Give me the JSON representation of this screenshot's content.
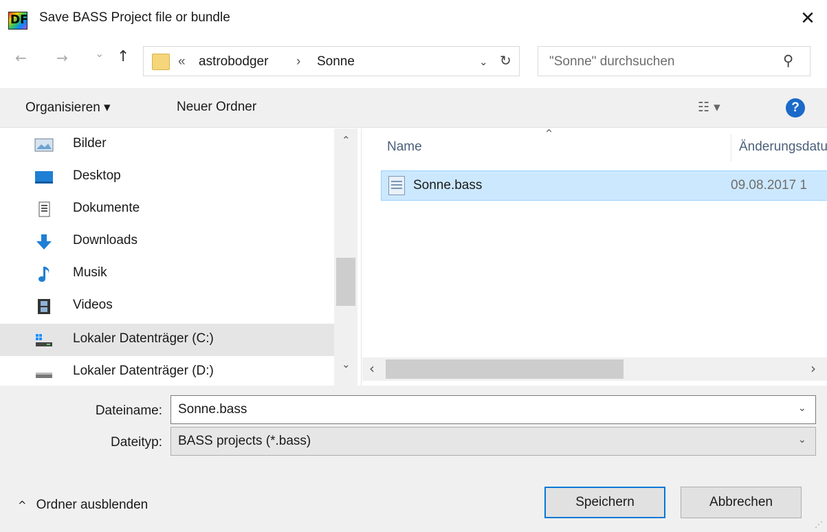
{
  "window": {
    "title": "Save BASS Project file or bundle",
    "close_glyph": "✕",
    "app_icon_text": "DF"
  },
  "nav": {
    "back_glyph": "←",
    "forward_glyph": "→",
    "recent_glyph": "⌄",
    "up_glyph": "↑",
    "breadcrumb_prefix": "«",
    "breadcrumb": [
      "astrobodger",
      "Sonne"
    ],
    "breadcrumb_sep": "›",
    "address_dropdown_glyph": "⌄",
    "refresh_glyph": "↻",
    "search_placeholder": "\"Sonne\" durchsuchen",
    "search_glyph": "⚲"
  },
  "toolbar": {
    "organize_label": "Organisieren ▾",
    "new_folder_label": "Neuer Ordner",
    "view_glyph": "☷ ▾",
    "help_glyph": "?"
  },
  "sidebar": {
    "items": [
      {
        "label": "Bilder",
        "icon": "pictures-icon",
        "selected": false
      },
      {
        "label": "Desktop",
        "icon": "desktop-icon",
        "selected": false
      },
      {
        "label": "Dokumente",
        "icon": "documents-icon",
        "selected": false
      },
      {
        "label": "Downloads",
        "icon": "downloads-icon",
        "selected": false
      },
      {
        "label": "Musik",
        "icon": "music-icon",
        "selected": false
      },
      {
        "label": "Videos",
        "icon": "videos-icon",
        "selected": false
      },
      {
        "label": "Lokaler Datenträger (C:)",
        "icon": "drive-c-icon",
        "selected": true
      },
      {
        "label": "Lokaler Datenträger (D:)",
        "icon": "drive-d-icon",
        "selected": false
      }
    ],
    "scroll_up_glyph": "⌃",
    "scroll_down_glyph": "⌄"
  },
  "files": {
    "columns": [
      "Name",
      "Änderungsdatum"
    ],
    "sort_glyph": "⌃",
    "rows": [
      {
        "name": "Sonne.bass",
        "modified": "09.08.2017 1",
        "selected": true
      }
    ],
    "scroll_left_glyph": "‹",
    "scroll_right_glyph": "›"
  },
  "form": {
    "filename_label": "Dateiname:",
    "filename_value": "Sonne.bass",
    "filetype_label": "Dateityp:",
    "filetype_value": "BASS projects (*.bass)",
    "dropdown_glyph": "⌄"
  },
  "footer": {
    "toggle_glyph": "^",
    "toggle_label": "Ordner ausblenden",
    "save_label": "Speichern",
    "cancel_label": "Abbrechen"
  },
  "colors": {
    "accent": "#0078d7",
    "selection": "#cce8ff",
    "selection_border": "#99d1ff",
    "help": "#1b6ac9"
  }
}
